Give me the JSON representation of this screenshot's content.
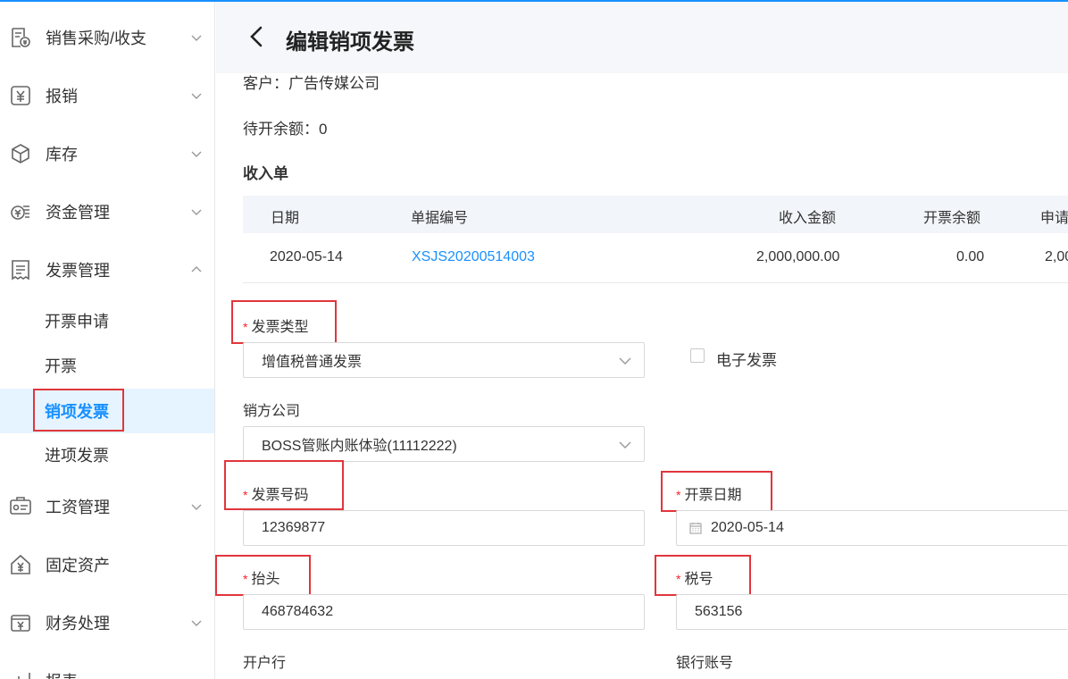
{
  "sidebar": {
    "items": [
      {
        "label": "销售采购/收支",
        "icon": "document-coin-icon"
      },
      {
        "label": "报销",
        "icon": "yuan-box-icon"
      },
      {
        "label": "库存",
        "icon": "cube-icon"
      },
      {
        "label": "资金管理",
        "icon": "coins-icon"
      },
      {
        "label": "发票管理",
        "icon": "invoice-icon",
        "expanded": true
      },
      {
        "label": "工资管理",
        "icon": "id-card-icon"
      },
      {
        "label": "固定资产",
        "icon": "house-yuan-icon"
      },
      {
        "label": "财务处理",
        "icon": "gear-yuan-icon"
      },
      {
        "label": "报表",
        "icon": "bar-chart-icon"
      }
    ],
    "sub_items": [
      {
        "label": "开票申请"
      },
      {
        "label": "开票"
      },
      {
        "label": "销项发票",
        "active": true
      },
      {
        "label": "进项发票"
      }
    ]
  },
  "header": {
    "title": "编辑销项发票"
  },
  "info": {
    "customer": "客户：广告传媒公司",
    "balance": "待开余额：0",
    "section_title": "收入单"
  },
  "table": {
    "headers": [
      "日期",
      "单据编号",
      "收入金额",
      "开票余额",
      "申请"
    ],
    "rows": [
      {
        "date": "2020-05-14",
        "number": "XSJS20200514003",
        "amount": "2,000,000.00",
        "balance": "0.00",
        "apply": "2,00"
      }
    ]
  },
  "form": {
    "invoice_type_label": "发票类型",
    "invoice_type_value": "增值税普通发票",
    "e_invoice_label": "电子发票",
    "seller_label": "销方公司",
    "seller_value": "BOSS管账内账体验(11112222)",
    "invoice_number_label": "发票号码",
    "invoice_number_value": "12369877",
    "invoice_date_label": "开票日期",
    "invoice_date_value": "2020-05-14",
    "title_label": "抬头",
    "title_value": "468784632",
    "tax_label": "税号",
    "tax_value": "563156",
    "bank_label": "开户行",
    "account_label": "银行账号",
    "required_mark": "*"
  },
  "colors": {
    "accent": "#1890ff",
    "highlight_box": "#e0363b",
    "required": "#f5222d"
  }
}
